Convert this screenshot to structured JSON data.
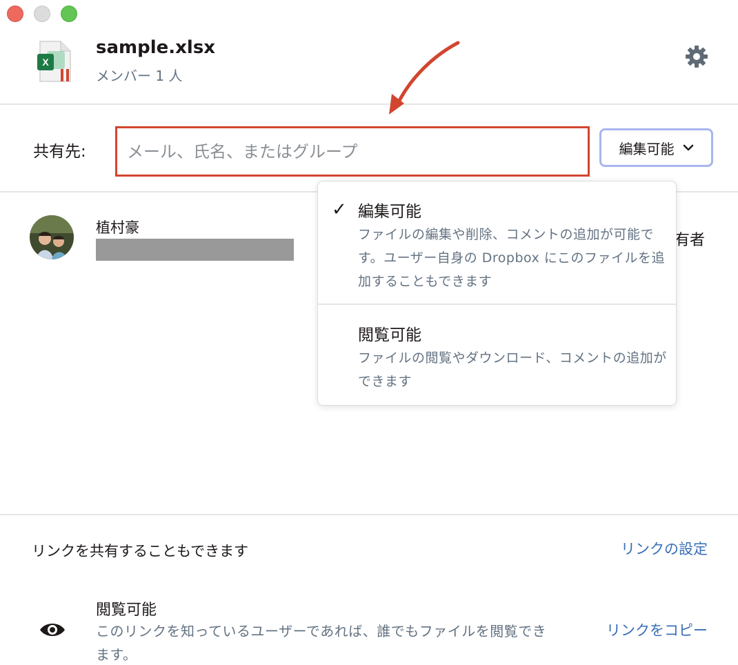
{
  "header": {
    "file_name": "sample.xlsx",
    "member_count": "メンバー 1 人",
    "file_icon": "excel-file-icon",
    "settings_icon": "gear-icon"
  },
  "share": {
    "label": "共有先:",
    "placeholder": "メール、氏名、またはグループ",
    "permission_button_label": "編集可能",
    "annotation_color": "#d2452f"
  },
  "members": [
    {
      "name": "植村豪",
      "role": "有者"
    }
  ],
  "permission_menu": {
    "items": [
      {
        "title": "編集可能",
        "checked": true,
        "check_mark": "✓",
        "description": "ファイルの編集や削除、コメントの追加が可能です。ユーザー自身の Dropbox にこのファイルを追加することもできます"
      },
      {
        "title": "閲覧可能",
        "checked": false,
        "check_mark": "",
        "description": "ファイルの閲覧やダウンロード、コメントの追加ができます"
      }
    ]
  },
  "link_section": {
    "heading": "リンクを共有することもできます",
    "settings_label": "リンクの設定",
    "permission_title": "閲覧可能",
    "permission_description": "このリンクを知っているユーザーであれば、誰でもファイルを閲覧できます。",
    "copy_label": "リンクをコピー",
    "link_color": "#3a6fb5"
  }
}
